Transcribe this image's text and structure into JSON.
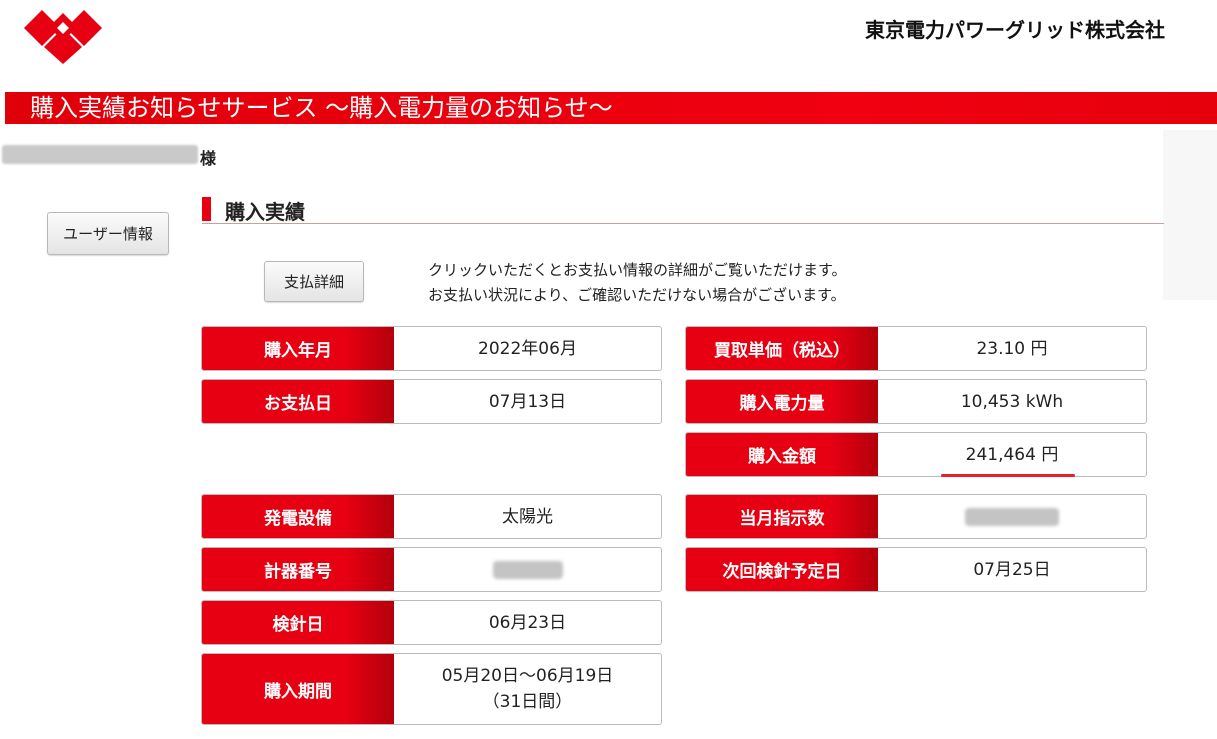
{
  "header": {
    "company_name": "東京電力パワーグリッド株式会社",
    "logo": "tepco-logo-icon",
    "brand_color": "#e60012"
  },
  "banner": {
    "title": "購入実績お知らせサービス ～購入電力量のお知らせ～"
  },
  "customer": {
    "honorific": "様"
  },
  "sidebar": {
    "user_info_label": "ユーザー情報"
  },
  "section": {
    "title": "購入実績",
    "detail_button": "支払詳細",
    "note_line1": "クリックいただくとお支払い情報の詳細がご覧いただけます。",
    "note_line2": "お支払い状況により、ご確認いただけない場合がございます。"
  },
  "records": {
    "purchase_month": {
      "label": "購入年月",
      "value": "2022年06月"
    },
    "payment_date": {
      "label": "お支払日",
      "value": "07月13日"
    },
    "unit_price": {
      "label": "買取単価（税込）",
      "value": "23.10 円"
    },
    "purchased_energy": {
      "label": "購入電力量",
      "value": "10,453 kWh"
    },
    "purchase_amount": {
      "label": "購入金額",
      "value": "241,464 円"
    },
    "generation_facility": {
      "label": "発電設備",
      "value": "太陽光"
    },
    "meter_reading": {
      "label": "当月指示数"
    },
    "meter_number": {
      "label": "計器番号"
    },
    "next_reading_date": {
      "label": "次回検針予定日",
      "value": "07月25日"
    },
    "reading_date": {
      "label": "検針日",
      "value": "06月23日"
    },
    "purchase_period": {
      "label": "購入期間",
      "value_line1": "05月20日～06月19日",
      "value_line2": "（31日間）"
    }
  }
}
